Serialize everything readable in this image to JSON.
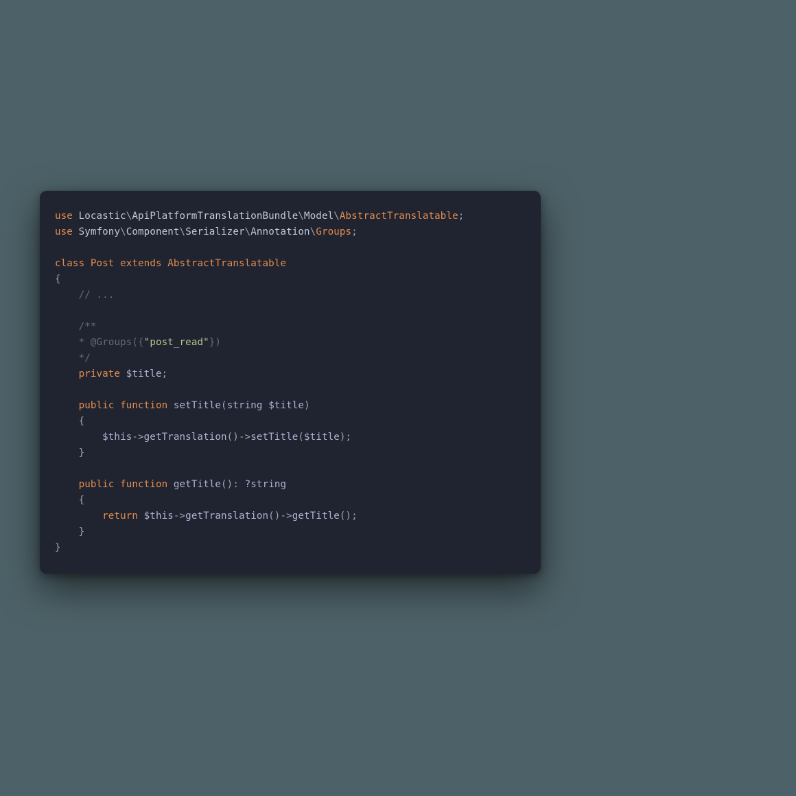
{
  "code": {
    "line1": {
      "use": "use",
      "ns1": "Locastic",
      "ns2": "ApiPlatformTranslationBundle",
      "ns3": "Model",
      "ns4": "AbstractTranslatable",
      "sep": "\\",
      "semi": ";"
    },
    "line2": {
      "use": "use",
      "ns1": "Symfony",
      "ns2": "Component",
      "ns3": "Serializer",
      "ns4": "Annotation",
      "ns5": "Groups",
      "sep": "\\",
      "semi": ";"
    },
    "line4": {
      "class": "class",
      "name": "Post",
      "extends": "extends",
      "parent": "AbstractTranslatable"
    },
    "line5": {
      "brace": "{"
    },
    "line6": {
      "comment": "// ..."
    },
    "line8": {
      "doc": "/**"
    },
    "line9": {
      "star": "*",
      "at": "@Groups",
      "paren_open": "({",
      "str": "\"post_read\"",
      "paren_close": "})"
    },
    "line10": {
      "doc": "*/"
    },
    "line11": {
      "private": "private",
      "var": "$title",
      "semi": ";"
    },
    "line13": {
      "public": "public",
      "function": "function",
      "name": "setTitle",
      "open": "(",
      "type": "string",
      "param": "$title",
      "close": ")"
    },
    "line14": {
      "brace": "{"
    },
    "line15": {
      "this": "$this",
      "arrow1": "->",
      "m1": "getTranslation",
      "p1": "()",
      "arrow2": "->",
      "m2": "setTitle",
      "open": "(",
      "arg": "$title",
      "close": ")",
      "semi": ";"
    },
    "line16": {
      "brace": "}"
    },
    "line18": {
      "public": "public",
      "function": "function",
      "name": "getTitle",
      "parens": "()",
      "colon": ":",
      "ret": "?string"
    },
    "line19": {
      "brace": "{"
    },
    "line20": {
      "return": "return",
      "this": "$this",
      "arrow1": "->",
      "m1": "getTranslation",
      "p1": "()",
      "arrow2": "->",
      "m2": "getTitle",
      "p2": "()",
      "semi": ";"
    },
    "line21": {
      "brace": "}"
    },
    "line22": {
      "brace": "}"
    }
  }
}
